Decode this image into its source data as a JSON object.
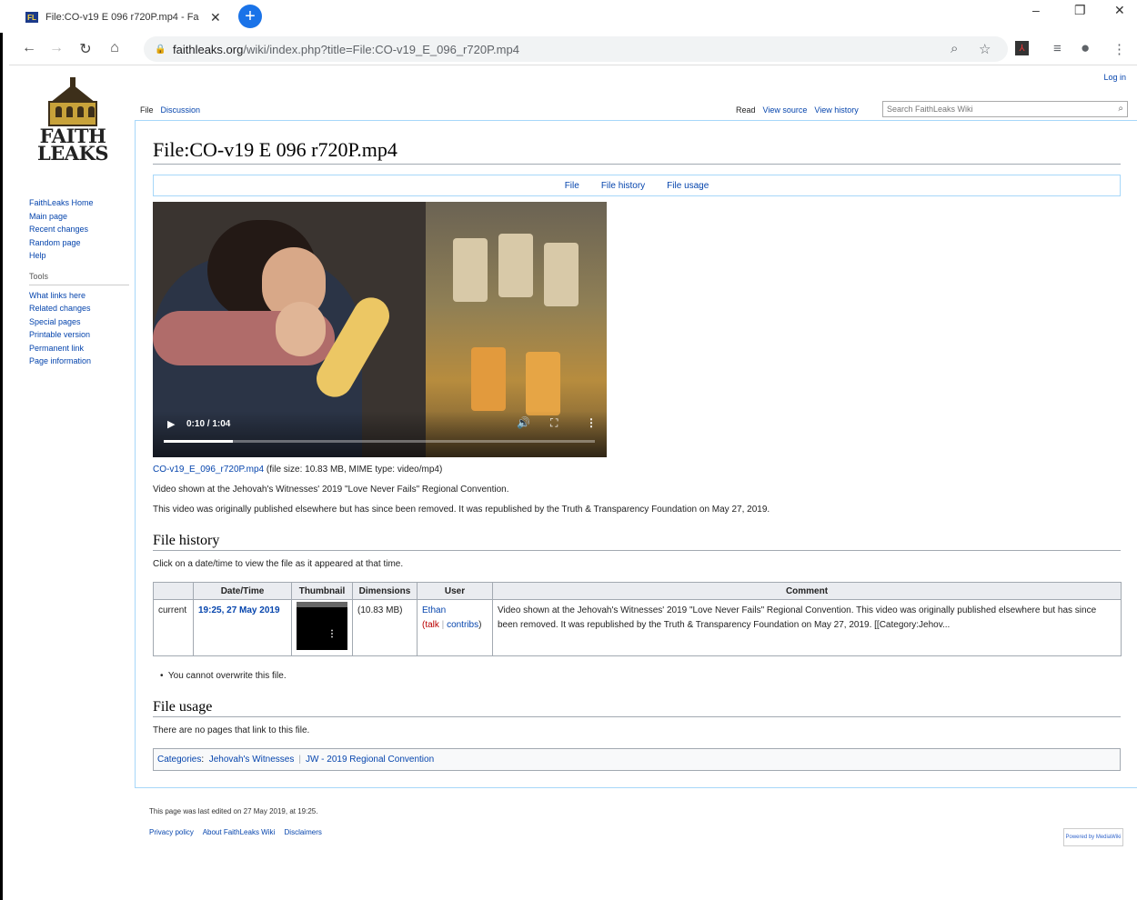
{
  "browser": {
    "tab_favicon": "FL",
    "tab_title": "File:CO-v19 E 096 r720P.mp4 - Fa",
    "url_host": "faithleaks.org",
    "url_path": "/wiki/index.php?title=File:CO-v19_E_096_r720P.mp4"
  },
  "header": {
    "login": "Log in",
    "tabs_left": [
      "File",
      "Discussion"
    ],
    "tabs_right": [
      "Read",
      "View source",
      "View history"
    ],
    "search_placeholder": "Search FaithLeaks Wiki"
  },
  "logo": {
    "line1": "FAITH",
    "line2": "LEAKS"
  },
  "sidebar": {
    "nav": [
      "FaithLeaks Home",
      "Main page",
      "Recent changes",
      "Random page",
      "Help"
    ],
    "tools_heading": "Tools",
    "tools": [
      "What links here",
      "Related changes",
      "Special pages",
      "Printable version",
      "Permanent link",
      "Page information"
    ]
  },
  "page": {
    "title": "File:CO-v19 E 096 r720P.mp4",
    "toc": [
      "File",
      "File history",
      "File usage"
    ],
    "video": {
      "time": "0:10 / 1:04",
      "progress": 0.16
    },
    "file_link": "CO-v19_E_096_r720P.mp4",
    "file_info": " (file size: 10.83 MB, MIME type: video/mp4)",
    "description": "Video shown at the Jehovah's Witnesses' 2019 \"Love Never Fails\" Regional Convention.",
    "note": "This video was originally published elsewhere but has since been removed. It was republished by the Truth & Transparency Foundation on May 27, 2019.",
    "history_heading": "File history",
    "history_hint": "Click on a date/time to view the file as it appeared at that time.",
    "history_table": {
      "headers": [
        "",
        "Date/Time",
        "Thumbnail",
        "Dimensions",
        "User",
        "Comment"
      ],
      "row": {
        "status": "current",
        "datetime": "19:25, 27 May 2019",
        "dimensions": " (10.83 MB)",
        "user": "Ethan",
        "user_talk": "talk",
        "user_contribs": "contribs",
        "comment": "Video shown at the Jehovah's Witnesses' 2019 \"Love Never Fails\" Regional Convention. This video was originally published elsewhere but has since been removed. It was republished by the Truth & Transparency Foundation on May 27, 2019. [[Category:Jehov..."
      }
    },
    "overwrite_note": "You cannot overwrite this file.",
    "usage_heading": "File usage",
    "usage_text": "There are no pages that link to this file.",
    "categories_label": "Categories",
    "categories": [
      "Jehovah's Witnesses",
      "JW - 2019 Regional Convention"
    ]
  },
  "footer": {
    "last_edited": "This page was last edited on 27 May 2019, at 19:25.",
    "links": [
      "Privacy policy",
      "About FaithLeaks Wiki",
      "Disclaimers"
    ],
    "badge": "Powered by MediaWiki"
  }
}
